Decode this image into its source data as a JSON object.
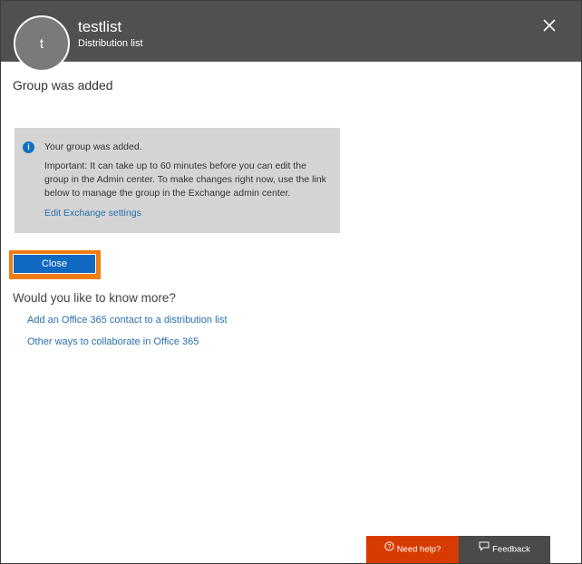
{
  "header": {
    "avatar_letter": "t",
    "title": "testlist",
    "subtitle": "Distribution list",
    "close_icon": "close-icon"
  },
  "main": {
    "heading": "Group was added",
    "info": {
      "icon": "info-icon",
      "line1": "Your group was added.",
      "line2": "Important: It can take up to 60 minutes before you can edit the group in the Admin center. To make changes right now, use the link below to manage the group in the Exchange admin center.",
      "link": "Edit Exchange settings"
    },
    "close_button": "Close",
    "more_heading": "Would you like to know more?",
    "links": [
      "Add an Office 365 contact to a distribution list",
      "Other ways to collaborate in Office 365"
    ]
  },
  "footer": {
    "help_label": "Need help?",
    "help_icon": "question-circle-icon",
    "feedback_label": "Feedback",
    "feedback_icon": "speech-bubble-icon"
  },
  "colors": {
    "header_bg": "#505050",
    "accent_blue": "#1069c1",
    "link_blue": "#2a6fb0",
    "focus_orange": "#f07d14",
    "help_red": "#d83b01",
    "feedback_gray": "#4a4a4a",
    "info_box_bg": "#d4d4d4"
  }
}
